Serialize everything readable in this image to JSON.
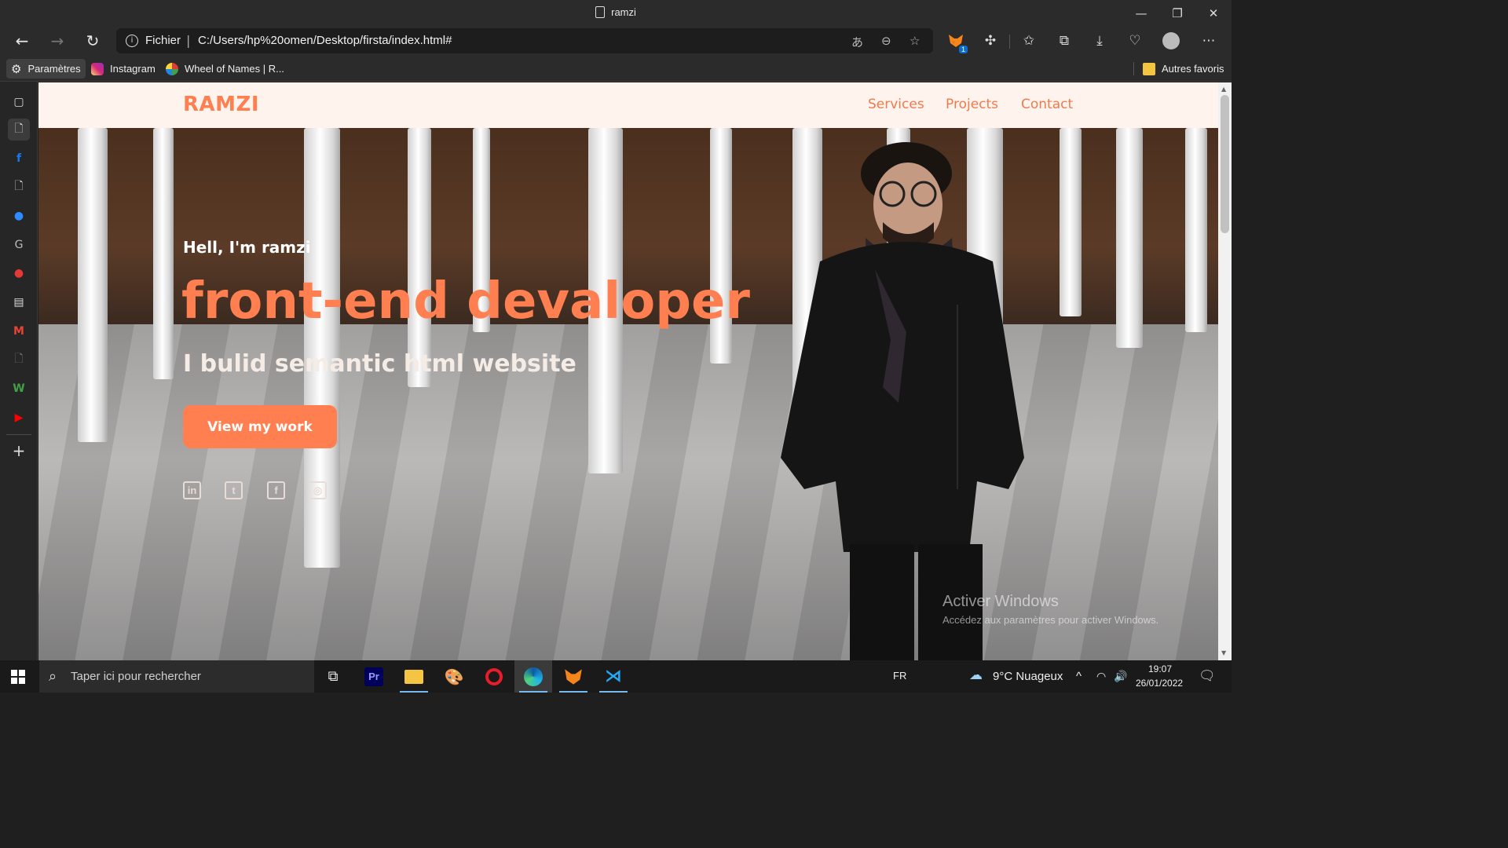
{
  "window": {
    "title": "ramzi"
  },
  "toolbar": {
    "scheme": "Fichier",
    "url": "C:/Users/hp%20omen/Desktop/firsta/index.html#",
    "extension_badge": "1"
  },
  "bookmarks": [
    {
      "label": "Paramètres"
    },
    {
      "label": "Instagram"
    },
    {
      "label": "Wheel of Names | R..."
    }
  ],
  "bookmarks_other": "Autres favoris",
  "site": {
    "logo": "RAMZI",
    "nav": [
      "Services",
      "Projects",
      "Contact"
    ],
    "hello": "Hell, I'm ramzi",
    "role": "front-end devaloper",
    "tagline": "I bulid semantic html website",
    "cta": "View my work",
    "social": [
      {
        "icon": "linkedin-icon",
        "glyph": "in"
      },
      {
        "icon": "twitter-icon",
        "glyph": "t"
      },
      {
        "icon": "facebook-icon",
        "glyph": "f"
      },
      {
        "icon": "instagram-icon",
        "glyph": "◎"
      }
    ]
  },
  "watermark": {
    "line1": "Activer Windows",
    "line2": "Accédez aux paramètres pour activer Windows."
  },
  "taskbar": {
    "search_placeholder": "Taper ici pour rechercher",
    "language": "FR",
    "weather": "9°C  Nuageux",
    "time": "19:07",
    "date": "26/01/2022"
  },
  "colors": {
    "accent": "#ff7f50",
    "nav_bg": "#fff4ed",
    "chrome": "#2b2b2b"
  }
}
